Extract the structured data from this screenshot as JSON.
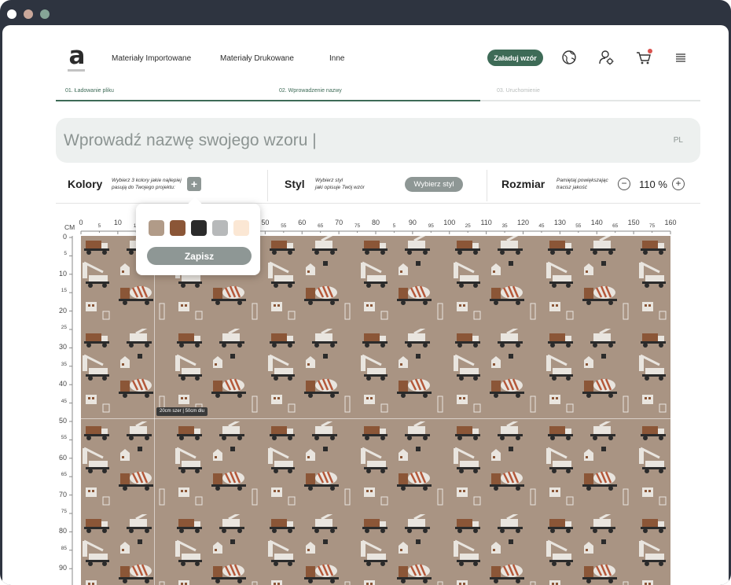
{
  "brand": {
    "logo_letter": "a"
  },
  "nav": {
    "items": [
      {
        "label": "Materiały Importowane"
      },
      {
        "label": "Materiały Drukowane"
      },
      {
        "label": "Inne"
      }
    ],
    "cta_label": "Załaduj wzór",
    "icons": [
      "globe-icon",
      "user-settings-icon",
      "cart-icon",
      "menu-icon"
    ]
  },
  "steps": [
    {
      "label": "01. Ładowanie pliku",
      "state": "done"
    },
    {
      "label": "02. Wprowadzenie nazwy",
      "state": "active"
    },
    {
      "label": "03. Uruchomienie",
      "state": "pending"
    }
  ],
  "name_field": {
    "value": "Wprowadź nazwę swojego wzoru |",
    "lang": "PL"
  },
  "options": {
    "colors": {
      "title": "Kolory",
      "hint_1": "Wybierz 3 kolory jakie najlepiej",
      "hint_2": "pasują do Twojego projektu:",
      "add_label": "+"
    },
    "style": {
      "title": "Styl",
      "hint_1": "Wybierz styl",
      "hint_2": "jaki opisuje Twój wzór",
      "button_label": "Wybierz styl"
    },
    "size": {
      "title": "Rozmiar",
      "hint_1": "Pamiętaj powiększając",
      "hint_2": "tracisz jakość",
      "minus": "−",
      "plus": "+",
      "zoom": "110 %"
    }
  },
  "color_popup": {
    "swatches": [
      "#b19b88",
      "#8b5637",
      "#2b2b2b",
      "#b7b9ba",
      "#fbe7d4"
    ],
    "save_label": "Zapisz"
  },
  "ruler": {
    "unit": "CM",
    "top": [
      {
        "v": "0",
        "major": true
      },
      {
        "v": "5",
        "major": false
      },
      {
        "v": "10",
        "major": true
      },
      {
        "v": "15",
        "major": false
      },
      {
        "v": "20",
        "major": true
      },
      {
        "v": "25",
        "major": false
      },
      {
        "v": "30",
        "major": true
      },
      {
        "v": "35",
        "major": false
      },
      {
        "v": "40",
        "major": true
      },
      {
        "v": "45",
        "major": false
      },
      {
        "v": "50",
        "major": true
      },
      {
        "v": "55",
        "major": false
      },
      {
        "v": "60",
        "major": true
      },
      {
        "v": "65",
        "major": false
      },
      {
        "v": "70",
        "major": true
      },
      {
        "v": "75",
        "major": false
      },
      {
        "v": "80",
        "major": true
      },
      {
        "v": "5",
        "major": false
      },
      {
        "v": "90",
        "major": true
      },
      {
        "v": "95",
        "major": false
      },
      {
        "v": "100",
        "major": true
      },
      {
        "v": "25",
        "major": false
      },
      {
        "v": "110",
        "major": true
      },
      {
        "v": "35",
        "major": false
      },
      {
        "v": "120",
        "major": true
      },
      {
        "v": "45",
        "major": false
      },
      {
        "v": "130",
        "major": true
      },
      {
        "v": "55",
        "major": false
      },
      {
        "v": "140",
        "major": true
      },
      {
        "v": "65",
        "major": false
      },
      {
        "v": "150",
        "major": true
      },
      {
        "v": "75",
        "major": false
      },
      {
        "v": "160",
        "major": true
      }
    ],
    "left": [
      {
        "v": "0",
        "major": true
      },
      {
        "v": "5",
        "major": false
      },
      {
        "v": "10",
        "major": true
      },
      {
        "v": "15",
        "major": false
      },
      {
        "v": "20",
        "major": true
      },
      {
        "v": "25",
        "major": false
      },
      {
        "v": "30",
        "major": true
      },
      {
        "v": "35",
        "major": false
      },
      {
        "v": "40",
        "major": true
      },
      {
        "v": "45",
        "major": false
      },
      {
        "v": "50",
        "major": true
      },
      {
        "v": "55",
        "major": false
      },
      {
        "v": "60",
        "major": true
      },
      {
        "v": "65",
        "major": false
      },
      {
        "v": "70",
        "major": true
      },
      {
        "v": "75",
        "major": false
      },
      {
        "v": "80",
        "major": true
      },
      {
        "v": "85",
        "major": false
      },
      {
        "v": "90",
        "major": true
      }
    ]
  },
  "dimension_tag": {
    "text": "20cm szer | 50cm dłu"
  },
  "colors": {
    "accent": "#3e6b57",
    "pattern_bg": "#a99483",
    "muted_button": "#8e9795"
  }
}
